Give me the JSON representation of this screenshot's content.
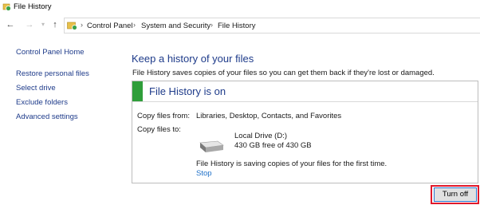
{
  "window": {
    "title": "File History"
  },
  "nav": {
    "back_icon": "back-arrow-icon",
    "forward_icon": "forward-arrow-icon",
    "up_icon": "up-arrow-icon"
  },
  "breadcrumb": [
    "Control Panel",
    "System and Security",
    "File History"
  ],
  "sidebar": {
    "home": "Control Panel Home",
    "items": [
      "Restore personal files",
      "Select drive",
      "Exclude folders",
      "Advanced settings"
    ]
  },
  "main": {
    "heading": "Keep a history of your files",
    "subtext": "File History saves copies of your files so you can get them back if they're lost or damaged.",
    "status_title": "File History is on",
    "copy_from_label": "Copy files from:",
    "copy_from_value": "Libraries, Desktop, Contacts, and Favorites",
    "copy_to_label": "Copy files to:",
    "drive_name": "Local Drive (D:)",
    "drive_space": "430 GB free of 430 GB",
    "saving_message": "File History is saving copies of your files for the first time.",
    "stop_link": "Stop",
    "turn_off_button": "Turn off"
  },
  "colors": {
    "accent_link": "#1e3b8a",
    "status_green": "#2f9e3a",
    "highlight_red": "#e0192b",
    "stop_link": "#1e70c8"
  }
}
